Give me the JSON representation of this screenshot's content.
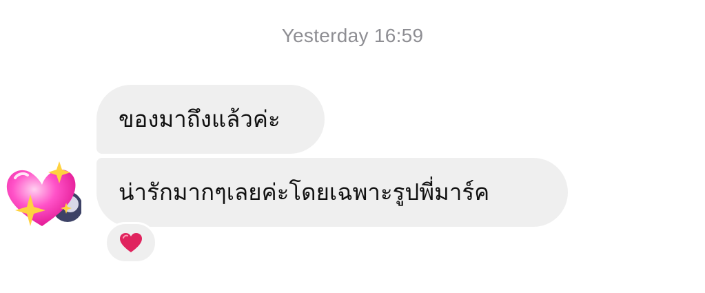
{
  "chat": {
    "timestamp": "Yesterday 16:59",
    "messages": [
      {
        "text": "ของมาถึงแล้วค่ะ"
      },
      {
        "text": "น่ารักมากๆเลยค่ะโดยเฉพาะรูปพี่มาร์ค"
      }
    ],
    "sender_avatar_icon": "sparkling-heart-avatar-icon",
    "reaction_icon": "red-heart-icon",
    "colors": {
      "bubble": "#efefef",
      "timestamp": "#8e8e93",
      "text": "#111111",
      "reaction_heart": "#e0245e",
      "avatar_heart": "#ff3fb4",
      "sparkle": "#ffd23f"
    }
  }
}
